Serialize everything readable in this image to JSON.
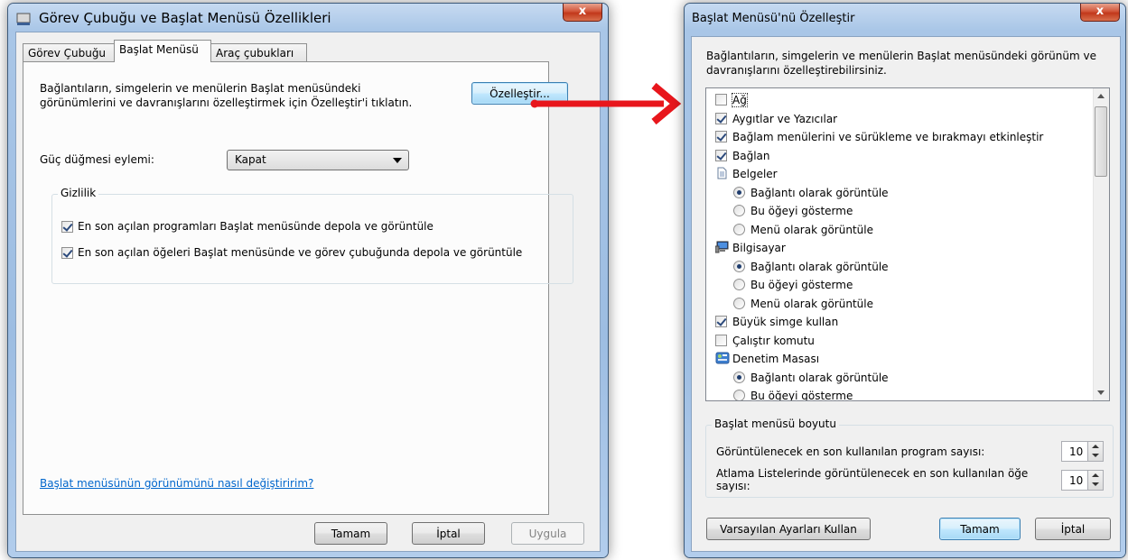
{
  "left_window": {
    "title": "Görev Çubuğu ve Başlat Menüsü Özellikleri",
    "close_label": "x",
    "tabs": [
      "Görev Çubuğu",
      "Başlat Menüsü",
      "Araç çubukları"
    ],
    "description_line1": "Bağlantıların, simgelerin ve menülerin Başlat menüsündeki",
    "description_line2": "görünümlerini ve davranışlarını özelleştirmek için Özelleştir'i tıklatın.",
    "customize_button": "Özelleştir...",
    "power_label": "Güç düğmesi eylemi:",
    "power_value": "Kapat",
    "privacy_group": "Gizlilik",
    "privacy_option1": "En son açılan programları Başlat menüsünde depola ve görüntüle",
    "privacy_option2": "En son açılan öğeleri Başlat menüsünde ve görev çubuğunda depola ve görüntüle",
    "help_link": "Başlat menüsünün görünümünü nasıl değiştiririm?",
    "ok_button": "Tamam",
    "cancel_button": "İptal",
    "apply_button": "Uygula"
  },
  "right_window": {
    "title": "Başlat Menüsü'nü Özelleştir",
    "close_label": "x",
    "description_line1": "Bağlantıların, simgelerin ve menülerin Başlat menüsündeki görünüm ve",
    "description_line2": "davranışlarını özelleştirebilirsiniz.",
    "list_items": [
      {
        "kind": "checkbox",
        "checked": false,
        "indent": 0,
        "label": "Ağ"
      },
      {
        "kind": "checkbox",
        "checked": true,
        "indent": 0,
        "label": "Aygıtlar ve Yazıcılar"
      },
      {
        "kind": "checkbox",
        "checked": true,
        "indent": 0,
        "label": "Bağlam menülerini ve sürükleme ve bırakmayı etkinleştir"
      },
      {
        "kind": "checkbox",
        "checked": true,
        "indent": 0,
        "label": "Bağlan"
      },
      {
        "kind": "folder",
        "icon": "document-icon",
        "indent": 0,
        "label": "Belgeler"
      },
      {
        "kind": "radio",
        "checked": true,
        "indent": 1,
        "label": "Bağlantı olarak görüntüle"
      },
      {
        "kind": "radio",
        "checked": false,
        "indent": 1,
        "label": "Bu öğeyi gösterme"
      },
      {
        "kind": "radio",
        "checked": false,
        "indent": 1,
        "label": "Menü olarak görüntüle"
      },
      {
        "kind": "folder",
        "icon": "computer-icon",
        "indent": 0,
        "label": "Bilgisayar"
      },
      {
        "kind": "radio",
        "checked": true,
        "indent": 1,
        "label": "Bağlantı olarak görüntüle"
      },
      {
        "kind": "radio",
        "checked": false,
        "indent": 1,
        "label": "Bu öğeyi gösterme"
      },
      {
        "kind": "radio",
        "checked": false,
        "indent": 1,
        "label": "Menü olarak görüntüle"
      },
      {
        "kind": "checkbox",
        "checked": true,
        "indent": 0,
        "label": "Büyük simge kullan"
      },
      {
        "kind": "checkbox",
        "checked": false,
        "indent": 0,
        "label": "Çalıştır komutu"
      },
      {
        "kind": "folder",
        "icon": "control-panel-icon",
        "indent": 0,
        "label": "Denetim Masası"
      },
      {
        "kind": "radio",
        "checked": true,
        "indent": 1,
        "label": "Bağlantı olarak görüntüle"
      },
      {
        "kind": "radio",
        "checked": false,
        "indent": 1,
        "label": "Bu öğeyi gösterme"
      }
    ],
    "size_group": "Başlat menüsü boyutu",
    "recent_programs_label": "Görüntülenecek en son kullanılan program sayısı:",
    "recent_programs_value": "10",
    "jumplist_label_line1": "Atlama Listelerinde görüntülenecek en son kullanılan öğe",
    "jumplist_label_line2": "sayısı:",
    "jumplist_value": "10",
    "defaults_button": "Varsayılan Ayarları Kullan",
    "ok_button": "Tamam",
    "cancel_button": "İptal"
  },
  "colors": {
    "arrow": "#e8161c",
    "link": "#0066cc",
    "accent_button": "#3c7fb1"
  }
}
